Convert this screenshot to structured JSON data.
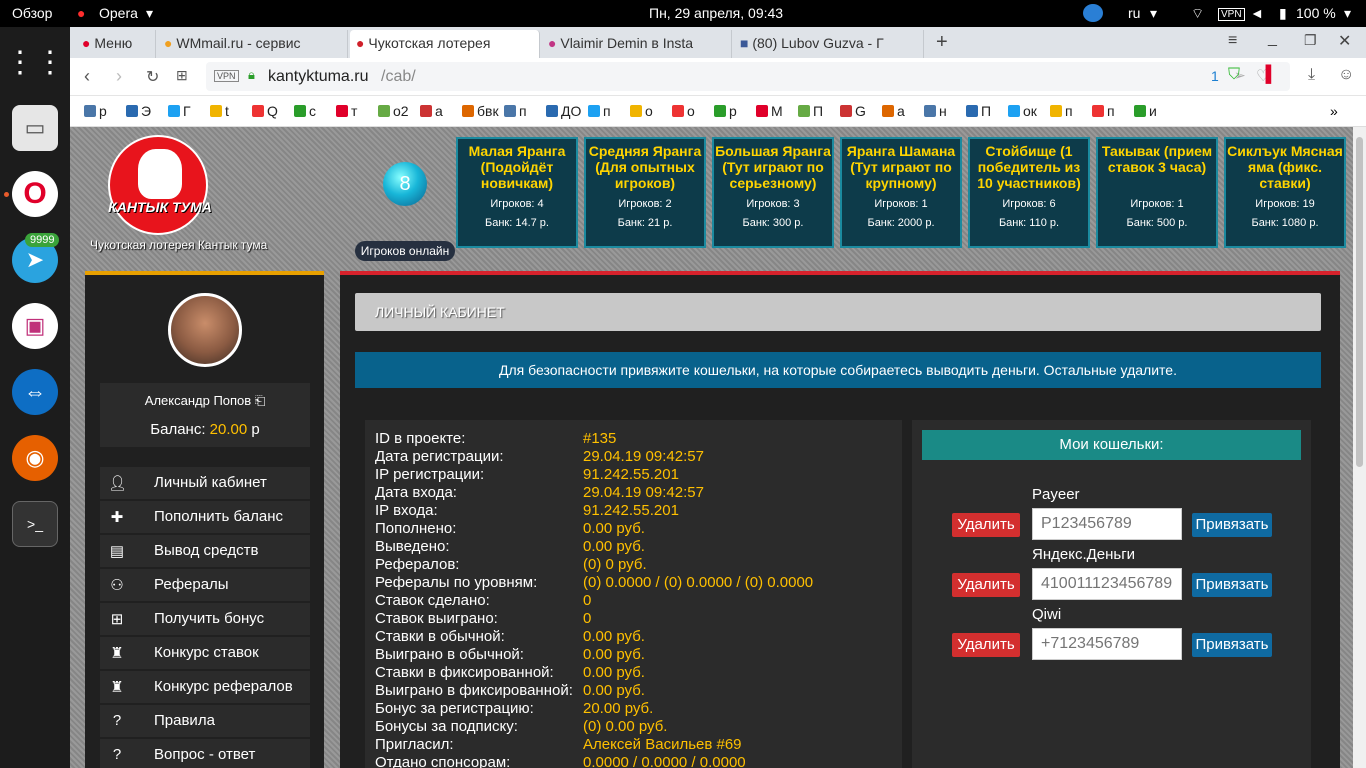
{
  "topbar": {
    "overview": "Обзор",
    "app": "Opera",
    "datetime": "Пн, 29 апреля, 09:43",
    "lang": "ru",
    "battery": "100 %"
  },
  "dock": {
    "telegram_badge": "9999"
  },
  "tabs": [
    {
      "label": "Меню"
    },
    {
      "label": "WMmail.ru - сервис"
    },
    {
      "label": "Чукотская лотерея"
    },
    {
      "label": "Vlaimir Demin в Insta"
    },
    {
      "label": "(80) Lubov Guzva - Г"
    }
  ],
  "url": {
    "host": "kantyktuma.ru",
    "path": "/cab/",
    "vpn": "VPN",
    "badge": "1"
  },
  "bookmarks": [
    "р",
    "Э",
    "Г",
    "t",
    "Q",
    "с",
    "т",
    "о2",
    "а",
    "бвк",
    "п",
    "ДО",
    "п",
    "о",
    "о",
    "р",
    "М",
    "П",
    "G",
    "а",
    "н",
    "П",
    "ок",
    "п",
    "п",
    "и"
  ],
  "site": {
    "logo_text": "КАНТЫК ТУМА",
    "caption": "Чукотская лотерея Кантык тума",
    "online_count": "8",
    "online_label": "Игроков онлайн"
  },
  "lotteries": [
    {
      "title": "Малая Яранга (Подойдёт новичкам)",
      "players": "Игроков: 4",
      "bank": "Банк: 14.7 р."
    },
    {
      "title": "Средняя Яранга (Для опытных игроков)",
      "players": "Игроков: 2",
      "bank": "Банк: 21 р."
    },
    {
      "title": "Большая Яранга (Тут играют по серьезному)",
      "players": "Игроков: 3",
      "bank": "Банк: 300 р."
    },
    {
      "title": "Яранга Шамана (Тут играют по крупному)",
      "players": "Игроков: 1",
      "bank": "Банк: 2000 р."
    },
    {
      "title": "Стойбище (1 победитель из 10 участников)",
      "players": "Игроков: 6",
      "bank": "Банк: 110 р."
    },
    {
      "title": "Такывак (прием ставок 3 часа)",
      "players": "Игроков: 1",
      "bank": "Банк: 500 р."
    },
    {
      "title": "Сиклъук Мясная яма (фикс. ставки)",
      "players": "Игроков: 19",
      "bank": "Банк: 1080 р."
    }
  ],
  "user": {
    "name": "Александр Попов",
    "balance_label": "Баланс:",
    "balance": "20.00",
    "currency": "р"
  },
  "menu": [
    {
      "label": "Личный кабинет",
      "icon": "user-icon"
    },
    {
      "label": "Пополнить баланс",
      "icon": "plus-icon"
    },
    {
      "label": "Вывод средств",
      "icon": "wallet-icon"
    },
    {
      "label": "Рефералы",
      "icon": "referrals-icon"
    },
    {
      "label": "Получить бонус",
      "icon": "gift-icon"
    },
    {
      "label": "Конкурс ставок",
      "icon": "trophy-icon"
    },
    {
      "label": "Конкурс рефералов",
      "icon": "trophy-icon"
    },
    {
      "label": "Правила",
      "icon": "question-icon"
    },
    {
      "label": "Вопрос - ответ",
      "icon": "question-icon"
    }
  ],
  "main": {
    "header": "ЛИЧНЫЙ КАБИНЕТ",
    "notice": "Для безопасности привяжите кошельки, на которые собираетесь выводить деньги. Остальные удалите."
  },
  "stats": [
    {
      "k": "ID в проекте:",
      "v": "#135"
    },
    {
      "k": "Дата регистрации:",
      "v": "29.04.19 09:42:57"
    },
    {
      "k": "IP регистрации:",
      "v": "91.242.55.201"
    },
    {
      "k": "Дата входа:",
      "v": "29.04.19 09:42:57"
    },
    {
      "k": "IP входа:",
      "v": "91.242.55.201"
    },
    {
      "k": "Пополнено:",
      "v": "0.00 руб."
    },
    {
      "k": "Выведено:",
      "v": "0.00 руб."
    },
    {
      "k": "Рефералов:",
      "v": "(0) 0 руб."
    },
    {
      "k": "Рефералы по уровням:",
      "v": "(0) 0.0000 / (0) 0.0000 / (0) 0.0000"
    },
    {
      "k": "Ставок сделано:",
      "v": "0"
    },
    {
      "k": "Ставок выиграно:",
      "v": "0"
    },
    {
      "k": "Ставки в обычной:",
      "v": "0.00 руб."
    },
    {
      "k": "Выиграно в обычной:",
      "v": "0.00 руб."
    },
    {
      "k": "Ставки в фиксированной:",
      "v": "0.00 руб."
    },
    {
      "k": "Выиграно в фиксированной:",
      "v": "0.00 руб."
    },
    {
      "k": "Бонус за регистрацию:",
      "v": "20.00 руб."
    },
    {
      "k": "Бонусы за подписку:",
      "v": "(0) 0.00 руб."
    },
    {
      "k": "Пригласил:",
      "v": "Алексей Васильев #69"
    },
    {
      "k": "Отдано спонсорам:",
      "v": "0.0000 / 0.0000 / 0.0000"
    }
  ],
  "wallets": {
    "title": "Мои кошельки:",
    "delete_label": "Удалить",
    "bind_label": "Привязать",
    "items": [
      {
        "name": "Payeer",
        "placeholder": "P123456789"
      },
      {
        "name": "Яндекс.Деньги",
        "placeholder": "410011123456789"
      },
      {
        "name": "Qiwi",
        "placeholder": "+7123456789"
      }
    ]
  },
  "colors": {
    "accent_yellow": "#ffc000",
    "notice_bg": "#08628c",
    "wallet_header": "#1a8a86",
    "delete_red": "#d32f2f",
    "bind_blue": "#0f6aa1"
  }
}
